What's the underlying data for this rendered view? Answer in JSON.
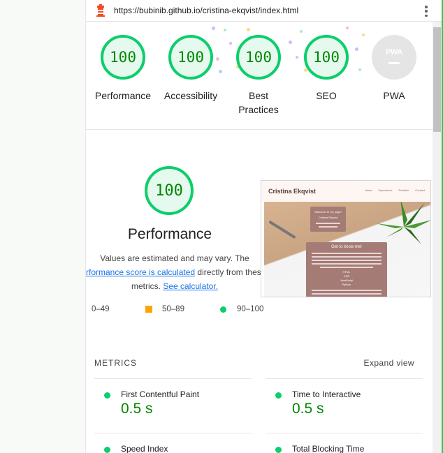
{
  "url": "https://bubinib.github.io/cristina-ekqvist/index.html",
  "colors": {
    "pass": "#0cce6b",
    "pass_text": "#008800",
    "average": "#ffa400",
    "link": "#1a73e8"
  },
  "gauges": [
    {
      "score": "100",
      "label": "Performance"
    },
    {
      "score": "100",
      "label": "Accessibility"
    },
    {
      "score": "100",
      "label": "Best Practices"
    },
    {
      "score": "100",
      "label": "SEO"
    },
    {
      "badge": "PWA",
      "label": "PWA"
    }
  ],
  "performance": {
    "score": "100",
    "title": "Performance",
    "desc_line1": "Values are estimated and may vary. The",
    "desc_link1": "rformance score is calculated",
    "desc_line2_rest": " directly from these",
    "desc_line3_pre": "metrics. ",
    "desc_link2": "See calculator."
  },
  "legend": {
    "fail": "0–49",
    "average": "50–89",
    "pass": "90–100"
  },
  "thumbnail": {
    "site_title": "Cristina Ekqvist",
    "nav": [
      "Home",
      "Experience",
      "Portfolio",
      "Contact"
    ],
    "card1_title": "Welcome to my page!",
    "card1_sub": "Cristina Ekqvist",
    "card2_title": "Get to know me!",
    "card2_items": [
      "HTML",
      "CSS",
      "JavaScript",
      "Python"
    ]
  },
  "metrics": {
    "title": "METRICS",
    "expand": "Expand view",
    "items": [
      {
        "name": "First Contentful Paint",
        "value": "0.5 s"
      },
      {
        "name": "Time to Interactive",
        "value": "0.5 s"
      },
      {
        "name": "Speed Index",
        "value": ""
      },
      {
        "name": "Total Blocking Time",
        "value": ""
      }
    ]
  }
}
